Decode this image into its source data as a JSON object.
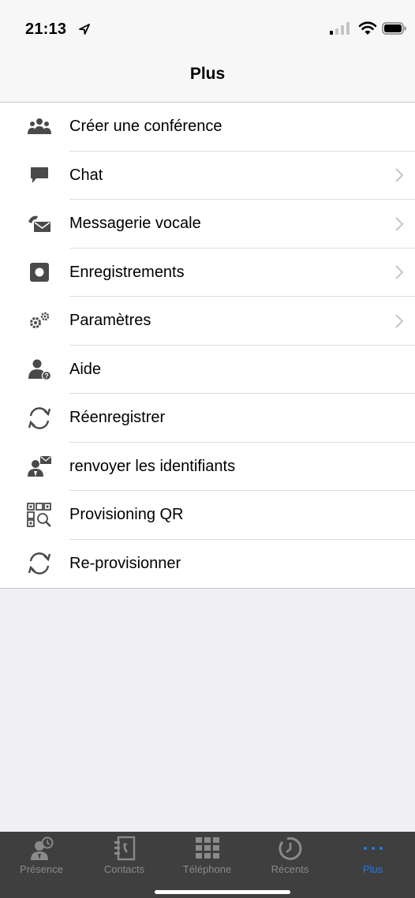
{
  "status_bar": {
    "time": "21:13"
  },
  "nav": {
    "title": "Plus"
  },
  "menu": {
    "items": [
      {
        "label": "Créer une conférence",
        "icon": "conference-icon",
        "chevron": false
      },
      {
        "label": "Chat",
        "icon": "chat-icon",
        "chevron": true
      },
      {
        "label": "Messagerie vocale",
        "icon": "voicemail-icon",
        "chevron": true
      },
      {
        "label": "Enregistrements",
        "icon": "recordings-icon",
        "chevron": true
      },
      {
        "label": "Paramètres",
        "icon": "gears-icon",
        "chevron": true
      },
      {
        "label": "Aide",
        "icon": "help-user-icon",
        "chevron": false
      },
      {
        "label": "Réenregistrer",
        "icon": "refresh-icon",
        "chevron": false
      },
      {
        "label": "renvoyer les identifiants",
        "icon": "user-mail-icon",
        "chevron": false
      },
      {
        "label": "Provisioning QR",
        "icon": "qr-scan-icon",
        "chevron": false
      },
      {
        "label": "Re-provisionner",
        "icon": "refresh-icon",
        "chevron": false
      }
    ]
  },
  "tabbar": {
    "tabs": [
      {
        "label": "Présence",
        "icon": "presence-icon",
        "active": false
      },
      {
        "label": "Contacts",
        "icon": "contacts-icon",
        "active": false
      },
      {
        "label": "Téléphone",
        "icon": "keypad-icon",
        "active": false
      },
      {
        "label": "Récents",
        "icon": "clock-icon",
        "active": false
      },
      {
        "label": "Plus",
        "icon": "more-dots-icon",
        "active": true
      }
    ]
  },
  "colors": {
    "accent": "#1a7cf0",
    "tabbar_bg": "#3f3f3f",
    "icon_grey": "#4a4a4a"
  }
}
